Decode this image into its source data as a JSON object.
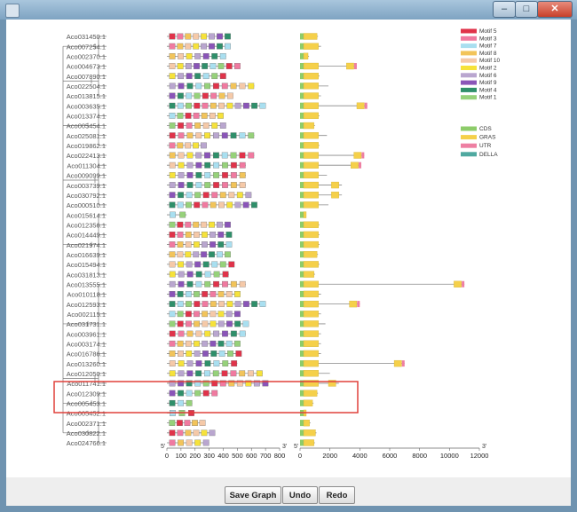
{
  "window": {
    "title": ""
  },
  "buttons": {
    "save": "Save Graph",
    "undo": "Undo",
    "redo": "Redo"
  },
  "colors": {
    "Motif 5": "#e0334a",
    "Motif 3": "#f07aa0",
    "Motif 7": "#a9dff0",
    "Motif 8": "#f2c45a",
    "Motif 10": "#f5c9a8",
    "Motif 2": "#f6e23a",
    "Motif 6": "#b9a6cf",
    "Motif 9": "#8a55b8",
    "Motif 4": "#2f8f6a",
    "Motif 1": "#96d17a",
    "CDS": "#8dcc6a",
    "GRAS": "#f5d04a",
    "UTR": "#ee7fa2",
    "DELLA": "#4fa9a0",
    "highlight": "#e0403a"
  },
  "legend_motifs": [
    "Motif 5",
    "Motif 3",
    "Motif 7",
    "Motif 8",
    "Motif 10",
    "Motif 2",
    "Motif 6",
    "Motif 9",
    "Motif 4",
    "Motif 1"
  ],
  "legend_genes": [
    "CDS",
    "GRAS",
    "UTR",
    "DELLA"
  ],
  "genes": [
    "Aco031450.1",
    "Aco007254.1",
    "Aco002370.1",
    "Aco004673.1",
    "Aco007890.1",
    "Aco022504.1",
    "Aco013815.1",
    "Aco003635.1",
    "Aco013374.1",
    "Aco005454.1",
    "Aco025081.1",
    "Aco019862.1",
    "Aco022413.1",
    "Aco011304.1",
    "Aco009099.1",
    "Aco003739.1",
    "Aco030792.1",
    "Aco000510.1",
    "Aco015614.1",
    "Aco012356.1",
    "Aco014449.1",
    "Aco021974.1",
    "Aco016639.1",
    "Aco015494.1",
    "Aco031813.1",
    "Aco013555.1",
    "Aco010118.1",
    "Aco012593.1",
    "Aco002115.1",
    "Aco031731.1",
    "Aco003961.1",
    "Aco003174.1",
    "Aco016786.1",
    "Aco013260.1",
    "Aco012050.1",
    "Aco011741.1",
    "Aco012309.1",
    "Aco005453.1",
    "Aco005452.1",
    "Aco002371.1",
    "Aco030822.1",
    "Aco024766.1"
  ],
  "motif_lengths": [
    450,
    450,
    420,
    520,
    420,
    620,
    470,
    700,
    400,
    420,
    620,
    280,
    620,
    560,
    560,
    560,
    600,
    640,
    140,
    450,
    460,
    460,
    450,
    480,
    440,
    560,
    520,
    700,
    520,
    580,
    560,
    520,
    530,
    500,
    680,
    720,
    360,
    180,
    200,
    270,
    340,
    300
  ],
  "gene_lengths": [
    1200,
    1400,
    600,
    3800,
    1300,
    1900,
    1400,
    4500,
    1300,
    1000,
    1800,
    1300,
    4300,
    4100,
    1800,
    2800,
    2800,
    1900,
    400,
    1300,
    1300,
    1300,
    1200,
    1300,
    1000,
    11000,
    1400,
    4000,
    1400,
    1700,
    1400,
    1400,
    1400,
    7000,
    2000,
    2600,
    1200,
    900,
    300,
    700,
    1100,
    1000
  ],
  "motif_axis": {
    "start_label": "5'",
    "end_label": "3'",
    "ticks": [
      "0",
      "100",
      "200",
      "300",
      "400",
      "500",
      "600",
      "700",
      "800"
    ],
    "max": 800
  },
  "gene_axis": {
    "start_label": "5'",
    "end_label": "3'",
    "ticks": [
      "0",
      "2000",
      "4000",
      "6000",
      "8000",
      "10000",
      "12000"
    ],
    "max": 12000
  }
}
